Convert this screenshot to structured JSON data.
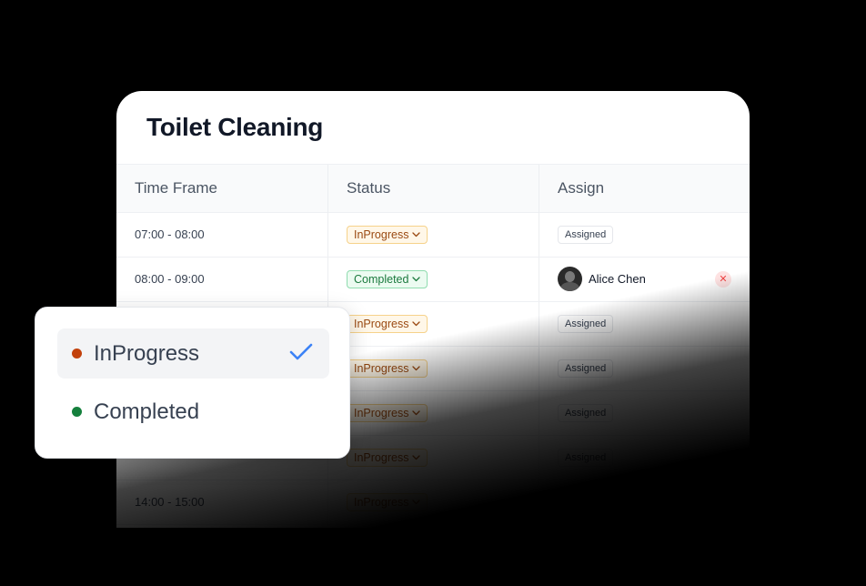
{
  "card": {
    "title": "Toilet Cleaning",
    "columns": [
      "Time Frame",
      "Status",
      "Assign"
    ],
    "rows": [
      {
        "time": "07:00  -  08:00",
        "status": "InProgress",
        "status_key": "inprogress",
        "assign": "Assigned"
      },
      {
        "time": "08:00  -  09:00",
        "status": "Completed",
        "status_key": "completed",
        "assignee": "Alice Chen"
      },
      {
        "time": "",
        "status": "InProgress",
        "status_key": "inprogress",
        "assign": "Assigned"
      },
      {
        "time": "",
        "status": "InProgress",
        "status_key": "inprogress",
        "assign": "Assigned"
      },
      {
        "time": "",
        "status": "InProgress",
        "status_key": "inprogress",
        "assign": "Assigned"
      },
      {
        "time": "",
        "status": "InProgress",
        "status_key": "inprogress",
        "assign": "Assigned"
      },
      {
        "time": "14:00  -  15:00",
        "status": "InProgress",
        "status_key": "inprogress",
        "assign": "Assigned"
      }
    ],
    "remove_glyph": "✕"
  },
  "dropdown": {
    "options": [
      {
        "label": "InProgress",
        "dot_color": "#c2410c",
        "selected": true
      },
      {
        "label": "Completed",
        "dot_color": "#15803d",
        "selected": false
      }
    ],
    "check_color": "#3b82f6"
  },
  "icons": {
    "pill_caret": "chevron-down-icon",
    "remove": "close-icon",
    "selected": "checkmark-icon"
  }
}
